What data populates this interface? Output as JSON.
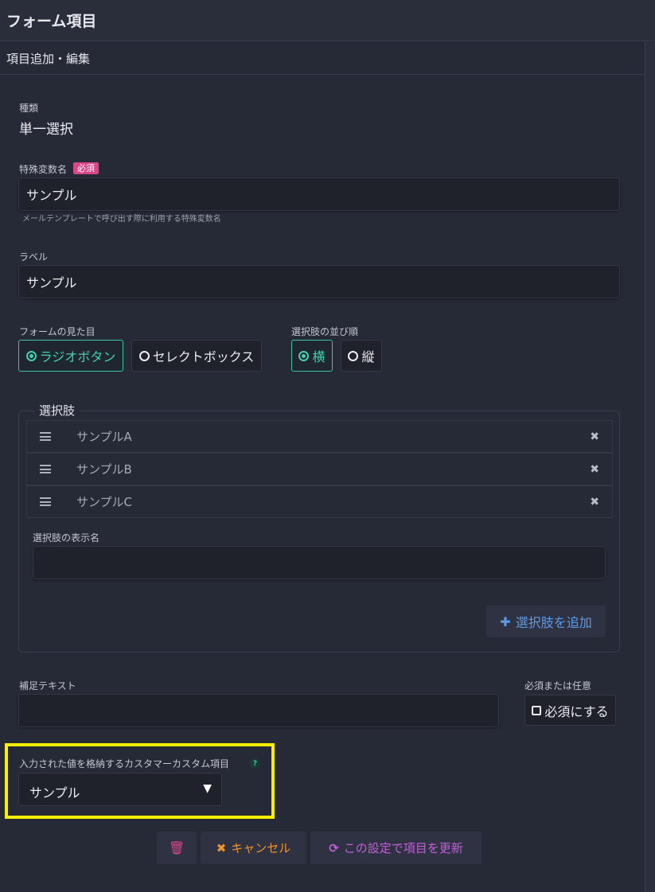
{
  "header": {
    "title": "フォーム項目"
  },
  "subheader": {
    "title": "項目追加・編集"
  },
  "type_field": {
    "label": "種類",
    "value": "単一選択"
  },
  "variable_field": {
    "label": "特殊変数名",
    "required_badge": "必須",
    "value": "サンプル",
    "help": "メールテンプレートで呼び出す際に利用する特殊変数名"
  },
  "label_field": {
    "label": "ラベル",
    "value": "サンプル"
  },
  "appearance": {
    "label": "フォームの見た目",
    "options": [
      "ラジオボタン",
      "セレクトボックス"
    ],
    "selected": "ラジオボタン"
  },
  "order": {
    "label": "選択肢の並び順",
    "options": [
      "横",
      "縦"
    ],
    "selected": "横"
  },
  "choices": {
    "legend": "選択肢",
    "items": [
      "サンプルA",
      "サンプルB",
      "サンプルC"
    ],
    "display_name_label": "選択肢の表示名",
    "display_name_value": "",
    "add_button": "選択肢を追加"
  },
  "supplement": {
    "label": "補足テキスト",
    "value": ""
  },
  "required_option": {
    "label": "必須または任意",
    "button": "必須にする"
  },
  "custom_field": {
    "label": "入力された値を格納するカスタマーカスタム項目",
    "help_icon": "?",
    "selected": "サンプル"
  },
  "actions": {
    "delete_icon": "trash-icon",
    "cancel": "キャンセル",
    "update": "この設定で項目を更新"
  },
  "colors": {
    "background": "#262936",
    "accent_green": "#42d1ae",
    "required_pink": "#d8478a",
    "add_blue": "#5b9be8",
    "cancel_orange": "#f0932b",
    "update_purple": "#c060d8",
    "highlight_yellow": "#ffee00"
  }
}
